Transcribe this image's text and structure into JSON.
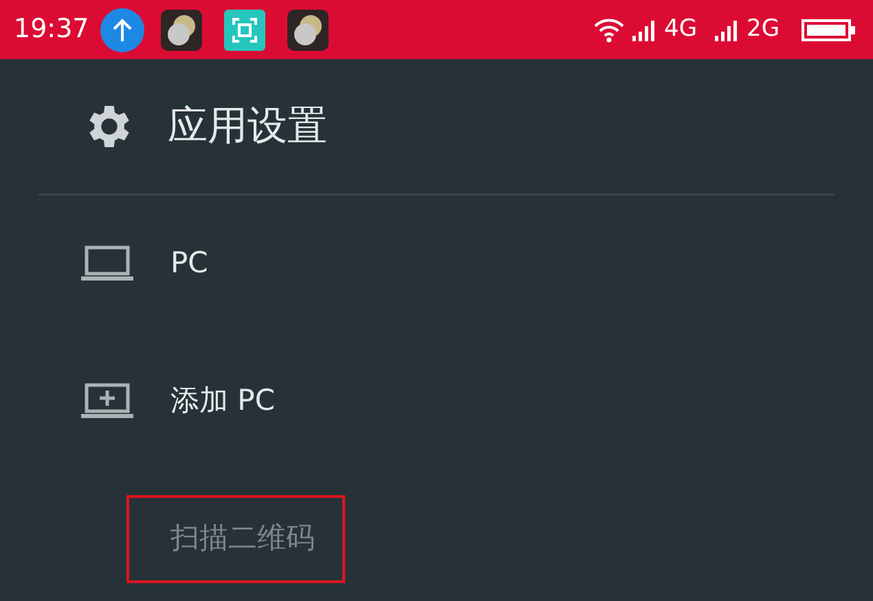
{
  "status_bar": {
    "time": "19:37",
    "networks": [
      {
        "label": "4G"
      },
      {
        "label": "2G"
      }
    ]
  },
  "header": {
    "title": "应用设置"
  },
  "items": [
    {
      "label": "PC",
      "kind": "laptop",
      "disabled": false,
      "highlighted": false
    },
    {
      "label": "添加 PC",
      "kind": "add",
      "disabled": false,
      "highlighted": false
    },
    {
      "label": "扫描二维码",
      "kind": "sub",
      "disabled": true,
      "highlighted": true
    }
  ]
}
